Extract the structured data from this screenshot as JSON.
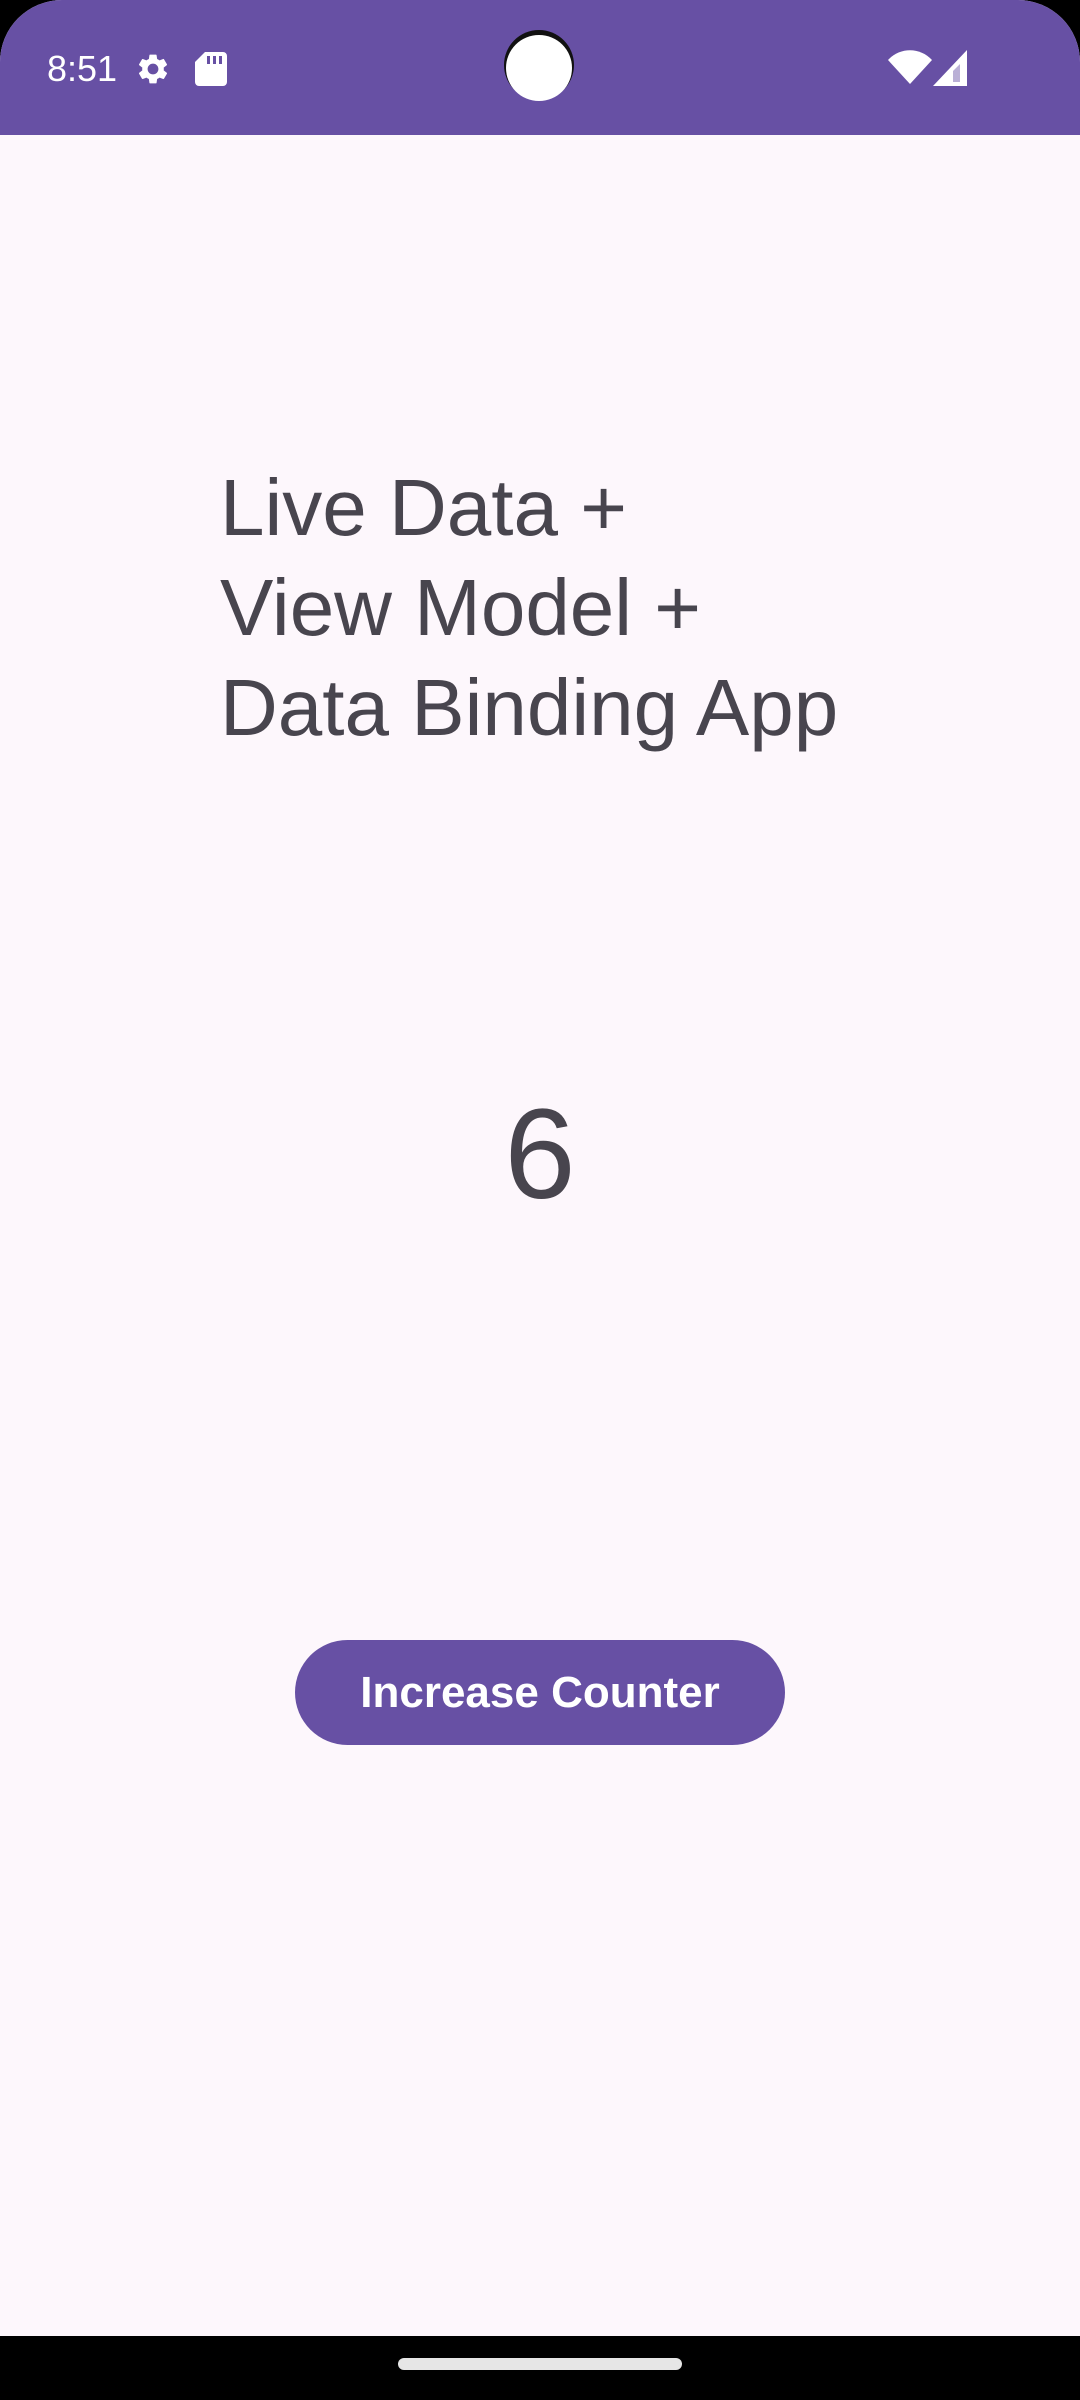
{
  "status_bar": {
    "time": "8:51",
    "icons": [
      "gear-icon",
      "sd-card-icon",
      "wifi-icon",
      "cellular-signal-icon"
    ],
    "background_color": "#6750a4"
  },
  "main": {
    "title": "Live Data +\nView Model +\nData Binding App",
    "counter_value": "6",
    "increase_button_label": "Increase Counter"
  },
  "theme": {
    "primary": "#6750a4",
    "background": "#fdf7fc",
    "text": "#48454e"
  }
}
